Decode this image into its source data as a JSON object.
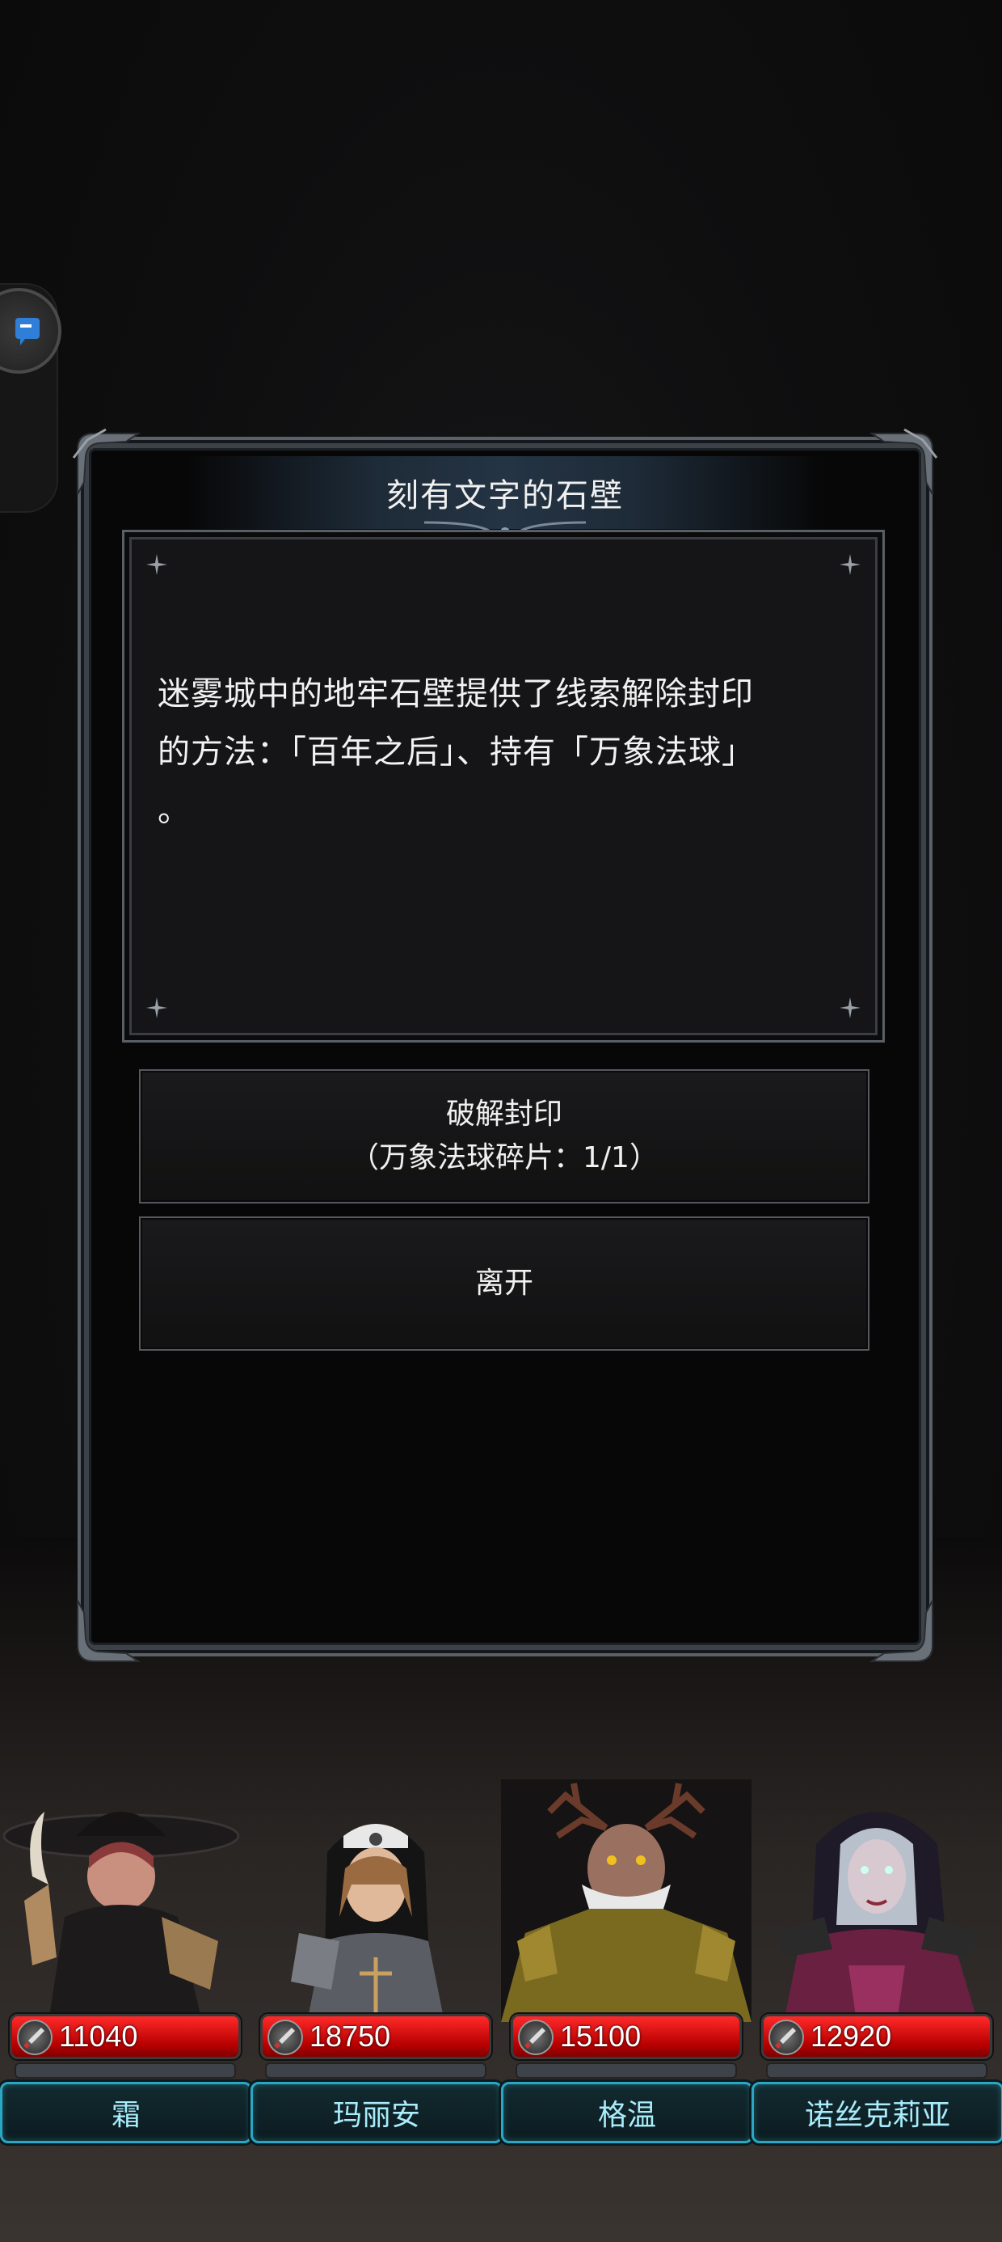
{
  "dialog": {
    "title": "刻有文字的石壁",
    "body_line1": "迷雾城中的地牢石壁提供了线索解除封印",
    "body_line2": "的方法：「百年之后」、持有「万象法球」",
    "body_line3": "。",
    "choices": [
      {
        "line1": "破解封印",
        "line2": "（万象法球碎片：1/1）"
      },
      {
        "line1": "离开"
      }
    ]
  },
  "party": [
    {
      "name": "霜",
      "hp": "11040",
      "portrait": "hooded-rogue-portrait"
    },
    {
      "name": "玛丽安",
      "hp": "18750",
      "portrait": "nun-warrior-portrait"
    },
    {
      "name": "格温",
      "hp": "15100",
      "portrait": "antlered-druid-portrait"
    },
    {
      "name": "诺丝克莉亚",
      "hp": "12920",
      "portrait": "dark-sorceress-portrait"
    }
  ],
  "colors": {
    "hp_red": "#d10000",
    "name_plate_border": "#2aa7c4",
    "name_text": "#a9ecfb",
    "frame": "#5a6168"
  },
  "icons": {
    "side_button": "chat-bubble-icon",
    "hp_icon": "sword-icon",
    "sparkle": "sparkle-icon"
  }
}
